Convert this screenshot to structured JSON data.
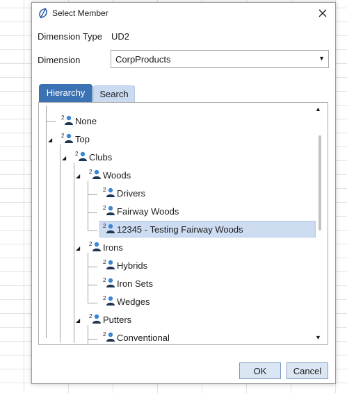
{
  "dialog": {
    "title": "Select Member",
    "logo_icon": "onestream-logo-icon",
    "close_icon": "close-icon"
  },
  "fields": {
    "dimension_type_label": "Dimension Type",
    "dimension_type_value": "UD2",
    "dimension_label": "Dimension",
    "dimension_value": "CorpProducts"
  },
  "tabs": [
    {
      "label": "Hierarchy",
      "active": true
    },
    {
      "label": "Search",
      "active": false
    }
  ],
  "tree": {
    "member_icon": "member-person-icon",
    "icon_badge": "2",
    "nodes": [
      {
        "label": "None",
        "depth": 0,
        "expander": "none"
      },
      {
        "label": "Top",
        "depth": 0,
        "expander": "expanded"
      },
      {
        "label": "Clubs",
        "depth": 1,
        "expander": "expanded"
      },
      {
        "label": "Woods",
        "depth": 2,
        "expander": "expanded"
      },
      {
        "label": "Drivers",
        "depth": 3,
        "expander": "none"
      },
      {
        "label": "Fairway Woods",
        "depth": 3,
        "expander": "none"
      },
      {
        "label": "12345 - Testing Fairway Woods",
        "depth": 3,
        "expander": "none",
        "selected": true
      },
      {
        "label": "Irons",
        "depth": 2,
        "expander": "expanded"
      },
      {
        "label": "Hybrids",
        "depth": 3,
        "expander": "none"
      },
      {
        "label": "Iron Sets",
        "depth": 3,
        "expander": "none"
      },
      {
        "label": "Wedges",
        "depth": 3,
        "expander": "none"
      },
      {
        "label": "Putters",
        "depth": 2,
        "expander": "expanded"
      },
      {
        "label": "Conventional",
        "depth": 3,
        "expander": "none"
      }
    ]
  },
  "buttons": {
    "ok": "OK",
    "cancel": "Cancel"
  },
  "colors": {
    "active_tab": "#3b72b3",
    "inactive_tab": "#c9daf1",
    "selected_row": "#cddcf1",
    "button_bg": "#dbe6f4",
    "member_icon_blue": "#3a86d4"
  }
}
